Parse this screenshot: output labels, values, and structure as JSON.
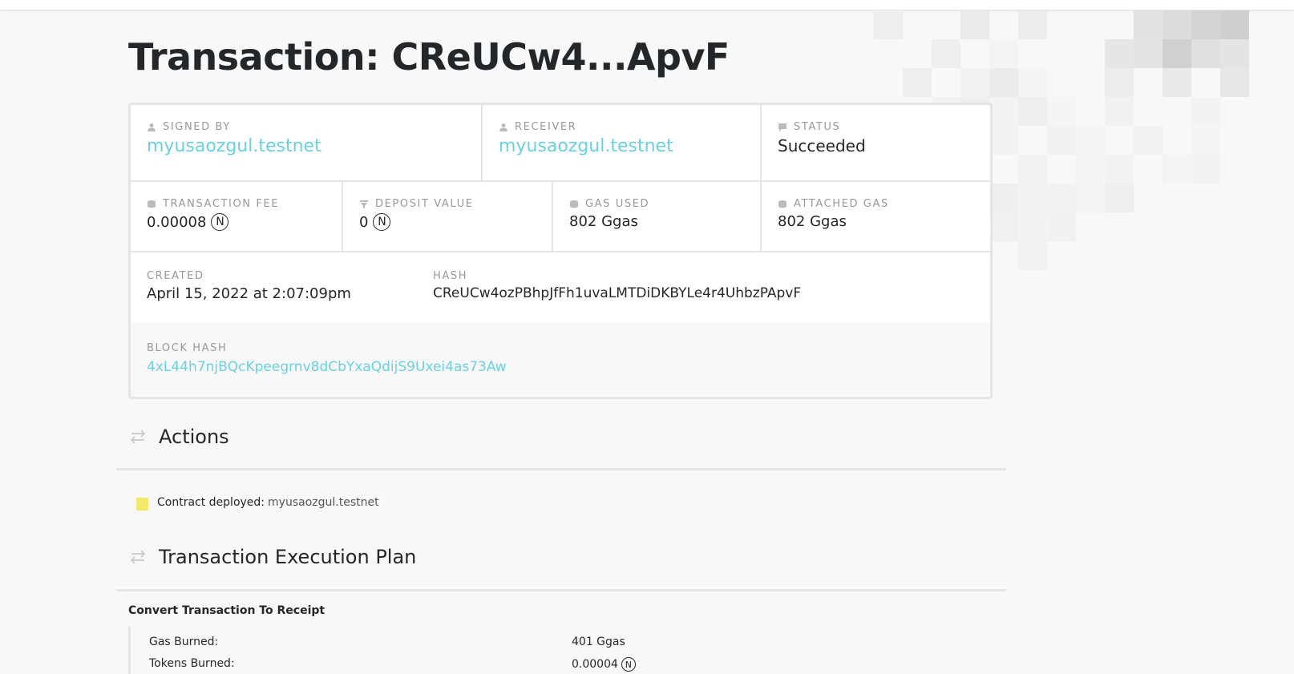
{
  "page": {
    "title": "Transaction: CReUCw4...ApvF"
  },
  "overview": {
    "signed_by": {
      "label": "SIGNED BY",
      "value": "myusaozgul.testnet"
    },
    "receiver": {
      "label": "RECEIVER",
      "value": "myusaozgul.testnet"
    },
    "status": {
      "label": "STATUS",
      "value": "Succeeded"
    },
    "transaction_fee": {
      "label": "TRANSACTION FEE",
      "value": "0.00008",
      "unit_icon": "near-token-icon"
    },
    "deposit_value": {
      "label": "DEPOSIT VALUE",
      "value": "0",
      "unit_icon": "near-token-icon"
    },
    "gas_used": {
      "label": "GAS USED",
      "value": "802 Ggas"
    },
    "attached_gas": {
      "label": "ATTACHED GAS",
      "value": "802 Ggas"
    },
    "created": {
      "label": "CREATED",
      "value": "April 15, 2022 at 2:07:09pm"
    },
    "hash": {
      "label": "HASH",
      "value": "CReUCw4ozPBhpJfFh1uvaLMTDiDKBYLe4r4UhbzPApvF"
    },
    "block_hash": {
      "label": "BLOCK HASH",
      "value": "4xL44h7njBQcKpeegrnv8dCbYxaQdijS9Uxei4as73Aw"
    }
  },
  "actions": {
    "heading": "Actions",
    "items": [
      {
        "label": "Contract deployed:",
        "target": "myusaozgul.testnet"
      }
    ]
  },
  "execution_plan": {
    "heading": "Transaction Execution Plan",
    "step_title": "Convert Transaction To Receipt",
    "rows": [
      {
        "key": "Gas Burned:",
        "value": "401 Ggas"
      },
      {
        "key": "Tokens Burned:",
        "value": "0.00004"
      }
    ]
  },
  "icons": {
    "user": "user-icon",
    "status": "comment-icon",
    "fee": "coins-icon",
    "deposit": "filter-icon",
    "gas": "coins-icon",
    "section": "arrows-exchange-icon",
    "near": "near-token-icon"
  },
  "colors": {
    "link": "#6ad1e3",
    "text": "#24272a",
    "label": "#999999",
    "border": "#e5e5e5",
    "contract_icon": "#f5e86b"
  }
}
